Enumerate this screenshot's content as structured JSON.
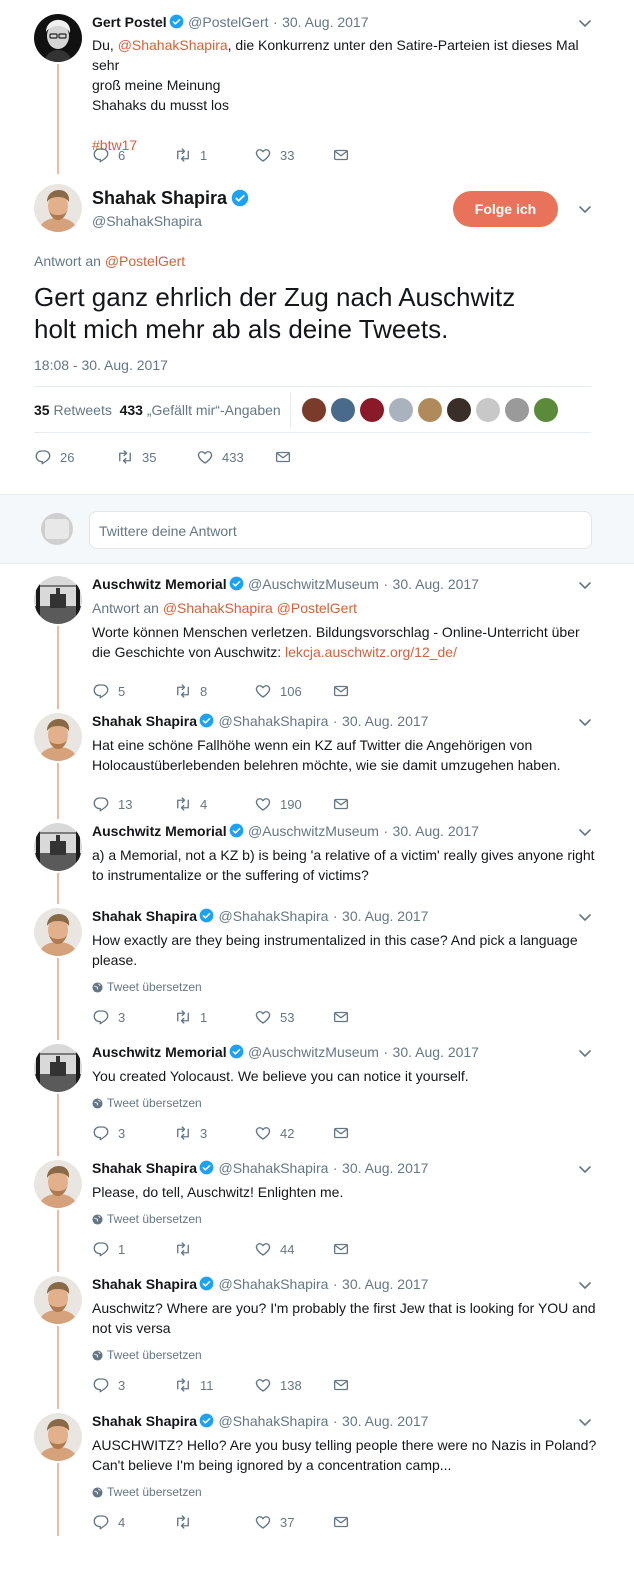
{
  "tweet0": {
    "name": "Gert Postel",
    "handle": "@PostelGert",
    "date": "30. Aug. 2017",
    "text_prefix": "Du, ",
    "mention": "@ShahakShapira",
    "text_rest": ", die Konkurrenz unter den Satire-Parteien ist dieses Mal sehr",
    "text_line2": "groß meine Meinung",
    "text_line3": "Shahaks du musst los",
    "hashtag": "#btw17",
    "replies": "6",
    "retweets": "1",
    "likes": "33"
  },
  "main": {
    "name": "Shahak Shapira",
    "handle": "@ShahakShapira",
    "follow_label": "Folge ich",
    "reply_to_label": "Antwort an",
    "reply_to_mention": "@PostelGert",
    "text_line1": "Gert ganz ehrlich der Zug nach Auschwitz",
    "text_line2": "holt mich mehr ab als deine Tweets.",
    "timestamp": "18:08 - 30. Aug. 2017",
    "retweet_count": "35",
    "retweet_label": "Retweets",
    "like_count": "433",
    "like_label": "„Gefällt mir“-Angaben",
    "replies": "26",
    "retweets": "35",
    "likes": "433"
  },
  "reply_box": {
    "placeholder": "Twittere deine Antwort"
  },
  "replies": [
    {
      "name": "Auschwitz Memorial",
      "handle": "@AuschwitzMuseum",
      "date": "30. Aug. 2017",
      "reply_label": "Antwort an",
      "reply_mentions": "@ShahakShapira @PostelGert",
      "line1": "Worte können Menschen verletzen. Bildungsvorschlag - Online-Unterricht über",
      "line2_prefix": "die Geschichte von Auschwitz: ",
      "line2_link": "lekcja.auschwitz.org/12_de/",
      "replies": "5",
      "retweets": "8",
      "likes": "106"
    },
    {
      "name": "Shahak Shapira",
      "handle": "@ShahakShapira",
      "date": "30. Aug. 2017",
      "line1": "Hat eine schöne Fallhöhe wenn ein KZ auf Twitter die Angehörigen von",
      "line2": "Holocaustüberlebenden belehren möchte, wie sie damit umzugehen haben.",
      "replies": "13",
      "retweets": "4",
      "likes": "190"
    },
    {
      "name": "Auschwitz Memorial",
      "handle": "@AuschwitzMuseum",
      "date": "30. Aug. 2017",
      "line1": "a) a Memorial, not a KZ b) is being 'a relative of a victim' really gives anyone right",
      "line2": "to instrumentalize or the suffering of victims?"
    },
    {
      "name": "Shahak Shapira",
      "handle": "@ShahakShapira",
      "date": "30. Aug. 2017",
      "line1": "How exactly are they being instrumentalized in this case? And pick a language",
      "line2": "please.",
      "translate": "Tweet übersetzen",
      "replies": "3",
      "retweets": "1",
      "likes": "53"
    },
    {
      "name": "Auschwitz Memorial",
      "handle": "@AuschwitzMuseum",
      "date": "30. Aug. 2017",
      "line1": "You created Yolocaust. We believe you can notice it yourself.",
      "translate": "Tweet übersetzen",
      "replies": "3",
      "retweets": "3",
      "likes": "42"
    },
    {
      "name": "Shahak Shapira",
      "handle": "@ShahakShapira",
      "date": "30. Aug. 2017",
      "line1": "Please, do tell, Auschwitz! Enlighten me.",
      "translate": "Tweet übersetzen",
      "replies": "1",
      "retweets": "",
      "likes": "44"
    },
    {
      "name": "Shahak Shapira",
      "handle": "@ShahakShapira",
      "date": "30. Aug. 2017",
      "line1": "Auschwitz? Where are you? I'm probably the first Jew that is looking for YOU and",
      "line2": "not vis versa",
      "translate": "Tweet übersetzen",
      "replies": "3",
      "retweets": "11",
      "likes": "138"
    },
    {
      "name": "Shahak Shapira",
      "handle": "@ShahakShapira",
      "date": "30. Aug. 2017",
      "line1": "AUSCHWITZ? Hello? Are you busy telling people there were no Nazis in Poland?",
      "line2": "Can't believe I'm being ignored by a concentration camp...",
      "translate": "Tweet übersetzen",
      "replies": "4",
      "retweets": "",
      "likes": "37"
    }
  ],
  "colors": {
    "accent": "#e8735a",
    "link": "#d65f3a",
    "verified": "#1da1f2",
    "thread": "#f2b6a3",
    "muted": "#657786"
  },
  "icons": [
    "reply-icon",
    "retweet-icon",
    "like-icon",
    "dm-icon",
    "verified-icon",
    "chevron-down-icon",
    "globe-icon"
  ]
}
